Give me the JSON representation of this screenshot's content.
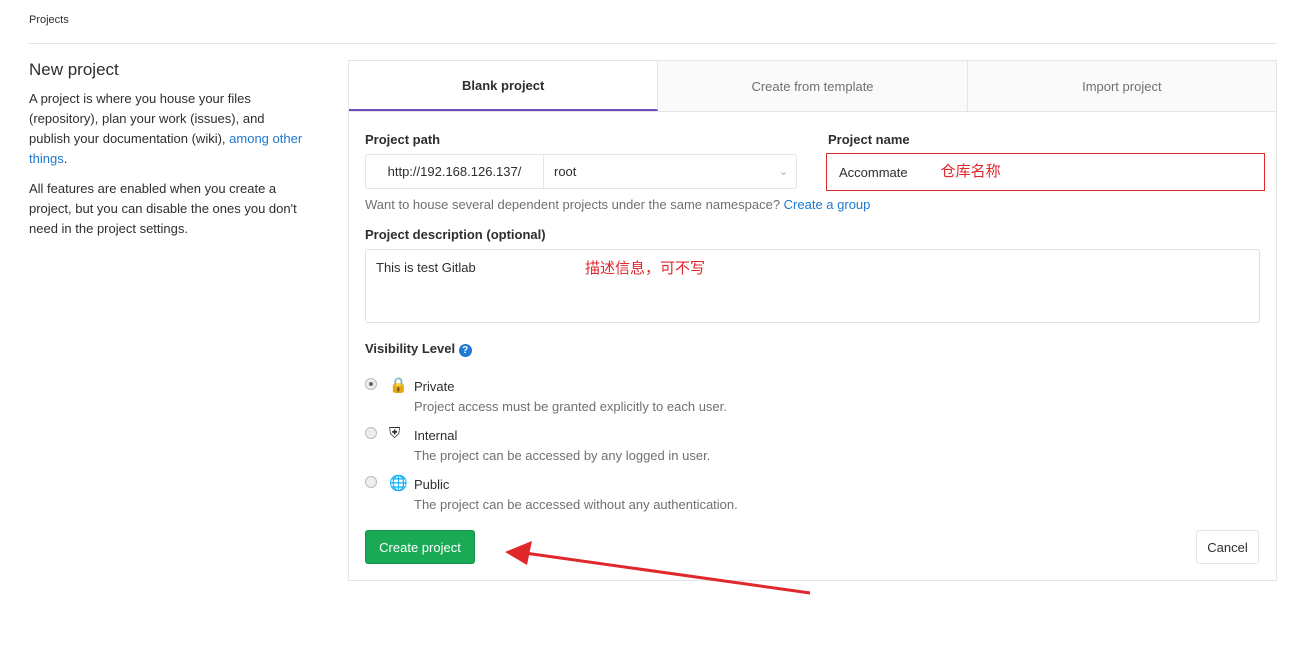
{
  "breadcrumb": "Projects",
  "left": {
    "title": "New project",
    "p1_a": "A project is where you house your files (repository), plan your work (issues), and publish your documentation (wiki), ",
    "p1_link": "among other things",
    "p1_end": ".",
    "p2": "All features are enabled when you create a project, but you can disable the ones you don't need in the project settings."
  },
  "tabs": [
    {
      "label": "Blank project",
      "active": true
    },
    {
      "label": "Create from template"
    },
    {
      "label": "Import project"
    }
  ],
  "form": {
    "path_label": "Project path",
    "path_prefix": "http://192.168.126.137/",
    "namespace": "root",
    "name_label": "Project name",
    "name_value": "Accommate",
    "hint": "Want to house several dependent projects under the same namespace? ",
    "hint_link": "Create a group",
    "desc_label": "Project description (optional)",
    "desc_value": "This is test Gitlab",
    "visibility_label": "Visibility Level",
    "options": [
      {
        "title": "Private",
        "desc": "Project access must be granted explicitly to each user.",
        "icon": "lock-icon",
        "checked": true
      },
      {
        "title": "Internal",
        "desc": "The project can be accessed by any logged in user.",
        "icon": "shield-icon"
      },
      {
        "title": "Public",
        "desc": "The project can be accessed without any authentication.",
        "icon": "globe-icon"
      }
    ],
    "create_label": "Create project",
    "cancel_label": "Cancel"
  },
  "annotations": {
    "name_note": "仓库名称",
    "desc_note": "描述信息，可不写",
    "color": "#e0272c"
  }
}
